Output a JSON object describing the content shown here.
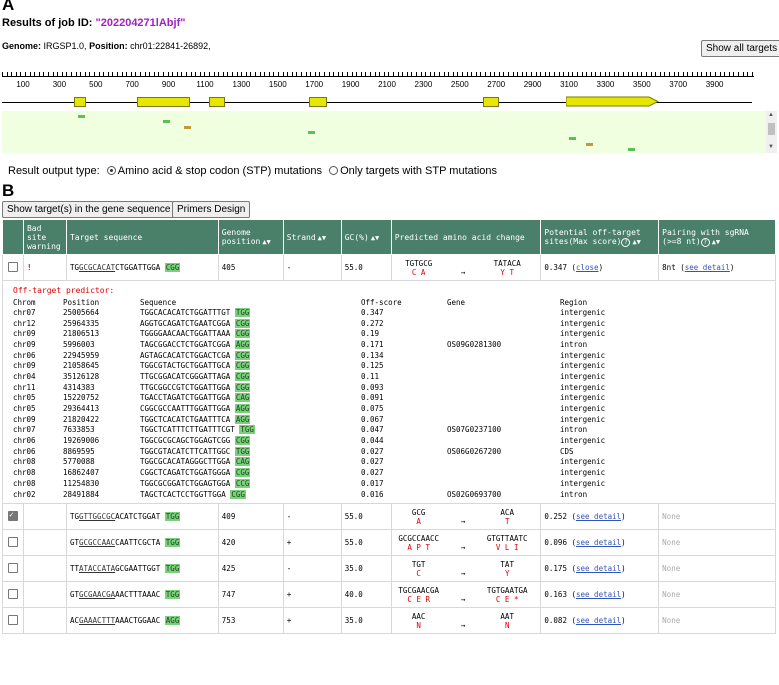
{
  "panels": {
    "a": "A",
    "b": "B"
  },
  "header": {
    "results_label": "Results of job ID:",
    "job_id": "\"202204271lAbjf\""
  },
  "genome": {
    "genome_label": "Genome:",
    "genome_value": "IRGSP1.0,",
    "position_label": "Position:",
    "position_value": "chr01:22841-26892,"
  },
  "buttons": {
    "show_all": "Show all targets",
    "show_in_gene": "Show target(s) in the gene sequence",
    "primers": "Primers Design"
  },
  "ruler_ticks": [
    "100",
    "300",
    "500",
    "700",
    "900",
    "1100",
    "1300",
    "1500",
    "1700",
    "1900",
    "2100",
    "2300",
    "2500",
    "2700",
    "2900",
    "3100",
    "3300",
    "3500",
    "3700",
    "3900"
  ],
  "output_type": {
    "label": "Result output type:",
    "opt1": "Amino acid & stop codon (STP) mutations",
    "opt2": "Only targets with STP mutations",
    "selected": "opt1"
  },
  "columns": [
    "Bad site warning",
    "Target sequence",
    "Genome position",
    "Strand",
    "GC(%)",
    "Predicted amino acid change",
    "Potential off-target sites(Max score)",
    "Pairing with sgRNA (>=8 nt)"
  ],
  "rows": [
    {
      "checked": false,
      "warning": "!",
      "seq_pre": "TG",
      "seq_u": "GCGCACAT",
      "seq_post": "CTGGATTGGA",
      "pam": "CGG",
      "pos": "405",
      "strand": "-",
      "gc": "55.0",
      "aa_from_nt": "TGTGCG",
      "aa_from": "C A",
      "aa_to_nt": "TATACA",
      "aa_to": "Y T",
      "off_score": "0.347",
      "off_link": "close",
      "pairing": "8nt",
      "pairing_link": "see detail"
    },
    {
      "checked": true,
      "warning": "",
      "seq_pre": "TG",
      "seq_u": "GTTGGCGC",
      "seq_post": "ACATCTGGAT",
      "pam": "TGG",
      "pos": "409",
      "strand": "-",
      "gc": "55.0",
      "aa_from_nt": "GCG",
      "aa_from": "A",
      "aa_to_nt": "ACA",
      "aa_to": "T",
      "off_score": "0.252",
      "off_link": "see detail",
      "pairing": "None",
      "pairing_link": ""
    },
    {
      "checked": false,
      "warning": "",
      "seq_pre": "GT",
      "seq_u": "GCGCCAAC",
      "seq_post": "CAATTCGCTA",
      "pam": "TGG",
      "pos": "420",
      "strand": "+",
      "gc": "55.0",
      "aa_from_nt": "GCGCCAACC",
      "aa_from": "A P T",
      "aa_to_nt": "GTGTTAATC",
      "aa_to": "V L I",
      "off_score": "0.096",
      "off_link": "see detail",
      "pairing": "None",
      "pairing_link": ""
    },
    {
      "checked": false,
      "warning": "",
      "seq_pre": "TT",
      "seq_u": "ATACCATA",
      "seq_post": "GCGAATTGGT",
      "pam": "TGG",
      "pos": "425",
      "strand": "-",
      "gc": "35.0",
      "aa_from_nt": "TGT",
      "aa_from": "C",
      "aa_to_nt": "TAT",
      "aa_to": "Y",
      "off_score": "0.175",
      "off_link": "see detail",
      "pairing": "None",
      "pairing_link": ""
    },
    {
      "checked": false,
      "warning": "",
      "seq_pre": "GT",
      "seq_u": "GCGAACGA",
      "seq_post": "AACTTTAAAC",
      "pam": "TGG",
      "pos": "747",
      "strand": "+",
      "gc": "40.0",
      "aa_from_nt": "TGCGAACGA",
      "aa_from": "C E R",
      "aa_to_nt": "TGTGAATGA",
      "aa_to": "C E *",
      "off_score": "0.163",
      "off_link": "see detail",
      "pairing": "None",
      "pairing_link": ""
    },
    {
      "checked": false,
      "warning": "",
      "seq_pre": "AC",
      "seq_u": "GAAACTTT",
      "seq_post": "AAACTGGAAC",
      "pam": "AGG",
      "pos": "753",
      "strand": "+",
      "gc": "35.0",
      "aa_from_nt": "AAC",
      "aa_from": "N",
      "aa_to_nt": "AAT",
      "aa_to": "N",
      "off_score": "0.082",
      "off_link": "see detail",
      "pairing": "None",
      "pairing_link": ""
    }
  ],
  "offtarget": {
    "title": "Off-target predictor:",
    "headers": [
      "Chrom",
      "Position",
      "Sequence",
      "Off-score",
      "Gene",
      "Region"
    ],
    "rows": [
      [
        "chr07",
        "25005664",
        "TGGCACACATCTGGATTTGT",
        "TGG",
        "0.347",
        "",
        "intergenic"
      ],
      [
        "chr12",
        "25964335",
        "AGGTGCAGATCTGAATCGGA",
        "CGG",
        "0.272",
        "",
        "intergenic"
      ],
      [
        "chr09",
        "21806513",
        "TGGGGAACAACTGGATTAAA",
        "CGG",
        "0.19",
        "",
        "intergenic"
      ],
      [
        "chr09",
        "5996003",
        "TAGCGGACCTCTGGATCGGA",
        "AGG",
        "0.171",
        "OS09G0281300",
        "intron"
      ],
      [
        "chr06",
        "22945959",
        "AGTAGCACATCTGGACTCGA",
        "CGG",
        "0.134",
        "",
        "intergenic"
      ],
      [
        "chr09",
        "21058645",
        "TGGCGTACTGCTGGATTGCA",
        "CGG",
        "0.125",
        "",
        "intergenic"
      ],
      [
        "chr04",
        "35126128",
        "TTGCGGACATCGGGATTAGA",
        "CGG",
        "0.11",
        "",
        "intergenic"
      ],
      [
        "chr11",
        "4314383",
        "TTGCGGCCGTCTGGATTGGA",
        "CGG",
        "0.093",
        "",
        "intergenic"
      ],
      [
        "chr05",
        "15220752",
        "TGACCTAGATCTGGATTGGA",
        "CAG",
        "0.091",
        "",
        "intergenic"
      ],
      [
        "chr05",
        "29364413",
        "CGGCGCCAATTTGGATTGGA",
        "AGG",
        "0.075",
        "",
        "intergenic"
      ],
      [
        "chr09",
        "21820422",
        "TGGCTCACATCTGAATTTCA",
        "AGG",
        "0.067",
        "",
        "intergenic"
      ],
      [
        "chr07",
        "7633853",
        "TGGCTCATTTCTTGATTTCGT",
        "TGG",
        "0.047",
        "OS07G0237100",
        "intron"
      ],
      [
        "chr06",
        "19269006",
        "TGGCGCGCAGCTGGAGTCGG",
        "CGG",
        "0.044",
        "",
        "intergenic"
      ],
      [
        "chr06",
        "8869595",
        "TGGCGTACATCTTCATTGGC",
        "TGG",
        "0.027",
        "OS06G0267200",
        "CDS"
      ],
      [
        "chr08",
        "5770088",
        "TGGCGCACATAGGGCTTGGA",
        "CAG",
        "0.027",
        "",
        "intergenic"
      ],
      [
        "chr08",
        "16862407",
        "CGGCTCAGATCTGGATGGGA",
        "CGG",
        "0.027",
        "",
        "intergenic"
      ],
      [
        "chr08",
        "11254830",
        "TGGCGCGGATCTGGAGTGGA",
        "CCG",
        "0.017",
        "",
        "intergenic"
      ],
      [
        "chr02",
        "28491884",
        "TAGCTCACTCCTGGTTGGA",
        "CGG",
        "0.016",
        "OS02G0693700",
        "intron"
      ]
    ]
  }
}
